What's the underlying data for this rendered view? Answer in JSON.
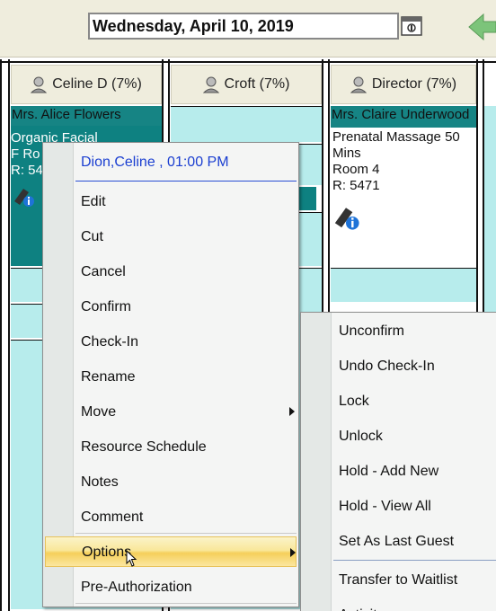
{
  "header": {
    "date": "Wednesday, April 10, 2019",
    "calendar_icon": "calendar-icon",
    "back_icon": "green-left-arrow-icon"
  },
  "columns": [
    {
      "label": "Celine D (7%)"
    },
    {
      "label": "Croft (7%)"
    },
    {
      "label": "Director (7%)"
    }
  ],
  "appointments": {
    "celine": {
      "client": "Mrs. Alice Flowers",
      "service": "Organic Facial",
      "line3": "F Ro",
      "line4": "R: 54"
    },
    "director": {
      "client": "Mrs. Claire Underwood",
      "service": "Prenatal Massage 50 Mins",
      "room": "Room 4",
      "ref": "R: 5471"
    }
  },
  "context_menu": {
    "header": "Dion,Celine , 01:00 PM",
    "items": [
      {
        "label": "Edit"
      },
      {
        "label": "Cut"
      },
      {
        "label": "Cancel"
      },
      {
        "label": "Confirm"
      },
      {
        "label": "Check-In"
      },
      {
        "label": "Rename"
      },
      {
        "label": "Move"
      },
      {
        "label": "Resource Schedule"
      },
      {
        "label": "Notes"
      },
      {
        "label": "Comment"
      },
      {
        "label": "Options"
      },
      {
        "label": "Pre-Authorization"
      }
    ],
    "highlighted": "Options"
  },
  "options_submenu": {
    "items": [
      {
        "label": "Unconfirm"
      },
      {
        "label": "Undo Check-In"
      },
      {
        "label": "Lock"
      },
      {
        "label": "Unlock"
      },
      {
        "label": "Hold - Add New"
      },
      {
        "label": "Hold - View All"
      },
      {
        "label": "Set As Last Guest"
      },
      {
        "label": "Transfer to Waitlist"
      },
      {
        "label": "Activity"
      }
    ]
  },
  "colors": {
    "header_bg": "#efeddd",
    "slot_cyan": "#b7ecec",
    "appt_teal": "#168484",
    "menu_link": "#1b3fd1",
    "highlight": "#f5cf5a"
  }
}
